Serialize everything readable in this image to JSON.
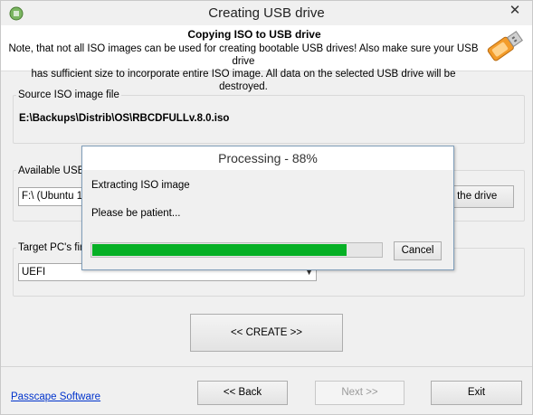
{
  "window": {
    "title": "Creating USB drive",
    "close_glyph": "✕",
    "app_icon": "usb-burn-icon"
  },
  "header": {
    "title": "Copying ISO to USB drive",
    "note_line1": "Note, that not all ISO images can be used for creating bootable USB drives! Also make sure your USB drive",
    "note_line2": "has sufficient size to incorporate entire ISO image. All data on the selected USB drive will be destroyed.",
    "icon": "usb-drive-icon"
  },
  "source": {
    "label": "Source ISO image file",
    "path": "E:\\Backups\\Distrib\\OS\\RBCDFULLv.8.0.iso"
  },
  "usb": {
    "label": "Available USB",
    "selected": "F:\\ (Ubuntu 1",
    "button_label": "ch the drive"
  },
  "target": {
    "label": "Target PC's fir",
    "selected": "UEFI"
  },
  "create_button": "<< CREATE >>",
  "footer": {
    "link": "Passcape Software",
    "back": "<< Back",
    "next": "Next >>",
    "exit": "Exit"
  },
  "dialog": {
    "title": "Processing - 88%",
    "line1": "Extracting ISO image",
    "line2": "Please be patient...",
    "progress": 0.88,
    "cancel": "Cancel",
    "fill_color": "#06b025"
  }
}
